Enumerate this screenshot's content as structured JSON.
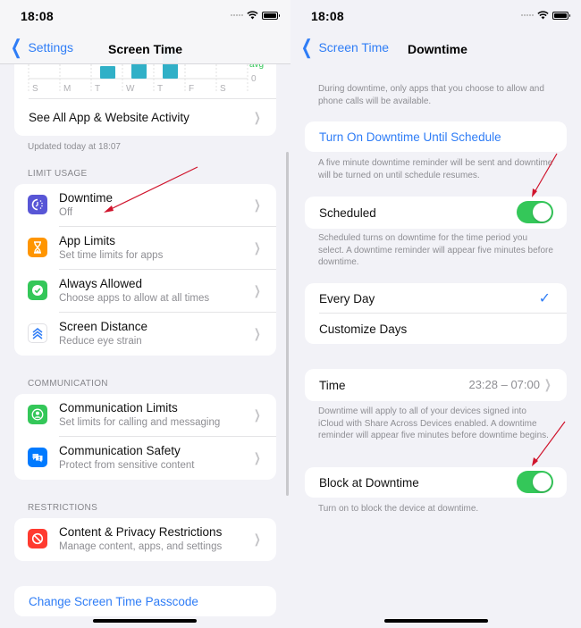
{
  "left": {
    "status_time": "18:08",
    "nav": {
      "back_label": "Settings",
      "title": "Screen Time"
    },
    "chart_data": {
      "type": "bar",
      "categories": [
        "S",
        "M",
        "T",
        "W",
        "T",
        "F",
        "S"
      ],
      "values": [
        0,
        0,
        0.35,
        0.55,
        0.9,
        0,
        0
      ],
      "axis_labels": {
        "avg": "avg",
        "zero": "0"
      },
      "bar_color": "#30b0c7",
      "avg_color": "#34c759"
    },
    "see_all_label": "See All App & Website Activity",
    "updated_text": "Updated today at 18:07",
    "sections": {
      "limit_usage": "LIMIT USAGE",
      "communication": "COMMUNICATION",
      "restrictions": "RESTRICTIONS"
    },
    "limit_items": [
      {
        "title": "Downtime",
        "subtitle": "Off",
        "icon": "downtime-icon",
        "color": "#5856d6"
      },
      {
        "title": "App Limits",
        "subtitle": "Set time limits for apps",
        "icon": "hourglass-icon",
        "color": "#ff9500"
      },
      {
        "title": "Always Allowed",
        "subtitle": "Choose apps to allow at all times",
        "icon": "checkmark-seal-icon",
        "color": "#34c759"
      },
      {
        "title": "Screen Distance",
        "subtitle": "Reduce eye strain",
        "icon": "chevrons-up-icon",
        "color": "#ffffff"
      }
    ],
    "communication_items": [
      {
        "title": "Communication Limits",
        "subtitle": "Set limits for calling and messaging",
        "icon": "person-circle-icon",
        "color": "#34c759"
      },
      {
        "title": "Communication Safety",
        "subtitle": "Protect from sensitive content",
        "icon": "chat-bubble-icon",
        "color": "#007aff"
      }
    ],
    "restriction_items": [
      {
        "title": "Content & Privacy Restrictions",
        "subtitle": "Manage content, apps, and settings",
        "icon": "no-entry-icon",
        "color": "#ff3b30"
      }
    ],
    "passcode_label": "Change Screen Time Passcode"
  },
  "right": {
    "status_time": "18:08",
    "nav": {
      "back_label": "Screen Time",
      "title": "Downtime"
    },
    "intro_text": "During downtime, only apps that you choose to allow and phone calls will be available.",
    "turn_on_label": "Turn On Downtime Until Schedule",
    "turn_on_note": "A five minute downtime reminder will be sent and downtime will be turned on until schedule resumes.",
    "scheduled": {
      "label": "Scheduled",
      "on": true
    },
    "scheduled_note": "Scheduled turns on downtime for the time period you select. A downtime reminder will appear five minutes before downtime.",
    "day_options": [
      {
        "label": "Every Day",
        "selected": true
      },
      {
        "label": "Customize Days",
        "selected": false
      }
    ],
    "time": {
      "label": "Time",
      "value": "23:28 – 07:00"
    },
    "time_note": "Downtime will apply to all of your devices signed into iCloud with Share Across Devices enabled. A downtime reminder will appear five minutes before downtime begins.",
    "block": {
      "label": "Block at Downtime",
      "on": true
    },
    "block_note": "Turn on to block the device at downtime."
  },
  "colors": {
    "accent": "#2f7df6",
    "toggle_on": "#34c759",
    "annotation_arrow": "#d0142c"
  }
}
